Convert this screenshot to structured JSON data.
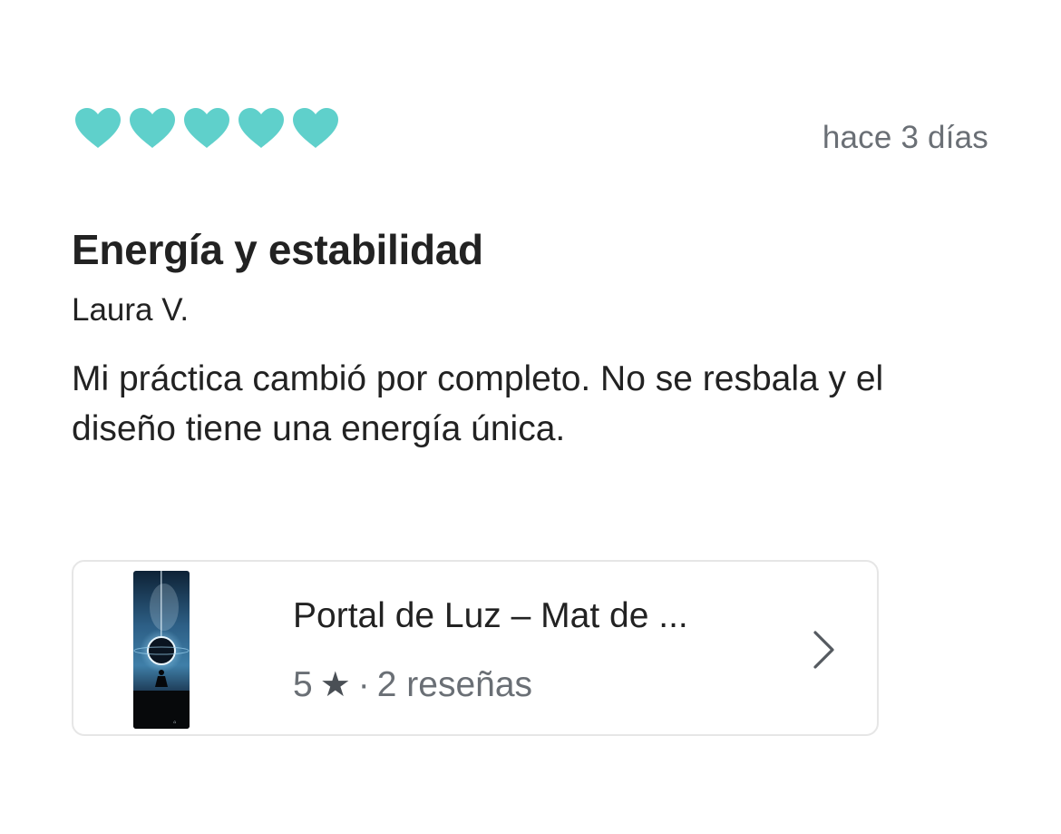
{
  "review": {
    "rating": 5,
    "rating_max": 5,
    "rating_icon": "heart-icon",
    "accent_color": "#5fd0cb",
    "date": "hace 3 días",
    "title": "Energía y estabilidad",
    "author": "Laura V.",
    "body": "Mi práctica cambió por completo. No se resbala y el diseño tiene una energía única."
  },
  "product": {
    "name": "Portal de Luz – Mat de ...",
    "rating_value": "5",
    "rating_star": "★",
    "separator": "·",
    "reviews_count": "2 reseñas",
    "chevron_icon": "chevron-right-icon"
  }
}
